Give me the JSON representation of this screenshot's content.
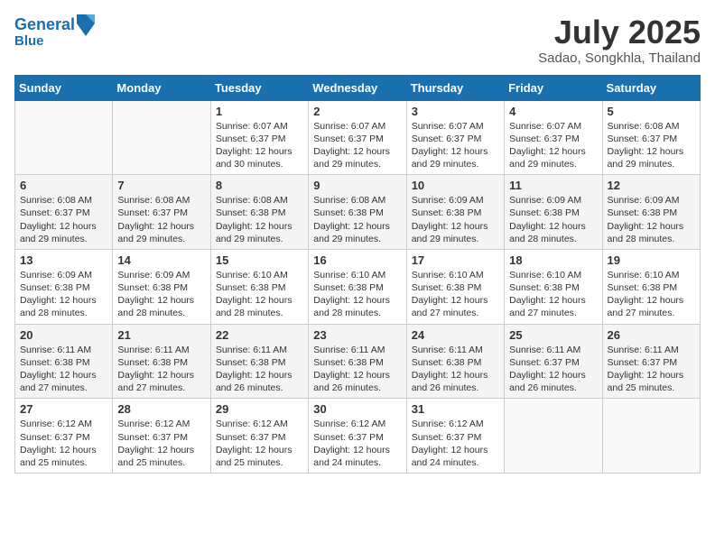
{
  "header": {
    "logo_line1": "General",
    "logo_line2": "Blue",
    "month_title": "July 2025",
    "location": "Sadao, Songkhla, Thailand"
  },
  "days_of_week": [
    "Sunday",
    "Monday",
    "Tuesday",
    "Wednesday",
    "Thursday",
    "Friday",
    "Saturday"
  ],
  "weeks": [
    [
      {
        "day": "",
        "empty": true
      },
      {
        "day": "",
        "empty": true
      },
      {
        "day": "1",
        "sunrise": "Sunrise: 6:07 AM",
        "sunset": "Sunset: 6:37 PM",
        "daylight": "Daylight: 12 hours and 30 minutes."
      },
      {
        "day": "2",
        "sunrise": "Sunrise: 6:07 AM",
        "sunset": "Sunset: 6:37 PM",
        "daylight": "Daylight: 12 hours and 29 minutes."
      },
      {
        "day": "3",
        "sunrise": "Sunrise: 6:07 AM",
        "sunset": "Sunset: 6:37 PM",
        "daylight": "Daylight: 12 hours and 29 minutes."
      },
      {
        "day": "4",
        "sunrise": "Sunrise: 6:07 AM",
        "sunset": "Sunset: 6:37 PM",
        "daylight": "Daylight: 12 hours and 29 minutes."
      },
      {
        "day": "5",
        "sunrise": "Sunrise: 6:08 AM",
        "sunset": "Sunset: 6:37 PM",
        "daylight": "Daylight: 12 hours and 29 minutes."
      }
    ],
    [
      {
        "day": "6",
        "sunrise": "Sunrise: 6:08 AM",
        "sunset": "Sunset: 6:37 PM",
        "daylight": "Daylight: 12 hours and 29 minutes."
      },
      {
        "day": "7",
        "sunrise": "Sunrise: 6:08 AM",
        "sunset": "Sunset: 6:37 PM",
        "daylight": "Daylight: 12 hours and 29 minutes."
      },
      {
        "day": "8",
        "sunrise": "Sunrise: 6:08 AM",
        "sunset": "Sunset: 6:38 PM",
        "daylight": "Daylight: 12 hours and 29 minutes."
      },
      {
        "day": "9",
        "sunrise": "Sunrise: 6:08 AM",
        "sunset": "Sunset: 6:38 PM",
        "daylight": "Daylight: 12 hours and 29 minutes."
      },
      {
        "day": "10",
        "sunrise": "Sunrise: 6:09 AM",
        "sunset": "Sunset: 6:38 PM",
        "daylight": "Daylight: 12 hours and 29 minutes."
      },
      {
        "day": "11",
        "sunrise": "Sunrise: 6:09 AM",
        "sunset": "Sunset: 6:38 PM",
        "daylight": "Daylight: 12 hours and 28 minutes."
      },
      {
        "day": "12",
        "sunrise": "Sunrise: 6:09 AM",
        "sunset": "Sunset: 6:38 PM",
        "daylight": "Daylight: 12 hours and 28 minutes."
      }
    ],
    [
      {
        "day": "13",
        "sunrise": "Sunrise: 6:09 AM",
        "sunset": "Sunset: 6:38 PM",
        "daylight": "Daylight: 12 hours and 28 minutes."
      },
      {
        "day": "14",
        "sunrise": "Sunrise: 6:09 AM",
        "sunset": "Sunset: 6:38 PM",
        "daylight": "Daylight: 12 hours and 28 minutes."
      },
      {
        "day": "15",
        "sunrise": "Sunrise: 6:10 AM",
        "sunset": "Sunset: 6:38 PM",
        "daylight": "Daylight: 12 hours and 28 minutes."
      },
      {
        "day": "16",
        "sunrise": "Sunrise: 6:10 AM",
        "sunset": "Sunset: 6:38 PM",
        "daylight": "Daylight: 12 hours and 28 minutes."
      },
      {
        "day": "17",
        "sunrise": "Sunrise: 6:10 AM",
        "sunset": "Sunset: 6:38 PM",
        "daylight": "Daylight: 12 hours and 27 minutes."
      },
      {
        "day": "18",
        "sunrise": "Sunrise: 6:10 AM",
        "sunset": "Sunset: 6:38 PM",
        "daylight": "Daylight: 12 hours and 27 minutes."
      },
      {
        "day": "19",
        "sunrise": "Sunrise: 6:10 AM",
        "sunset": "Sunset: 6:38 PM",
        "daylight": "Daylight: 12 hours and 27 minutes."
      }
    ],
    [
      {
        "day": "20",
        "sunrise": "Sunrise: 6:11 AM",
        "sunset": "Sunset: 6:38 PM",
        "daylight": "Daylight: 12 hours and 27 minutes."
      },
      {
        "day": "21",
        "sunrise": "Sunrise: 6:11 AM",
        "sunset": "Sunset: 6:38 PM",
        "daylight": "Daylight: 12 hours and 27 minutes."
      },
      {
        "day": "22",
        "sunrise": "Sunrise: 6:11 AM",
        "sunset": "Sunset: 6:38 PM",
        "daylight": "Daylight: 12 hours and 26 minutes."
      },
      {
        "day": "23",
        "sunrise": "Sunrise: 6:11 AM",
        "sunset": "Sunset: 6:38 PM",
        "daylight": "Daylight: 12 hours and 26 minutes."
      },
      {
        "day": "24",
        "sunrise": "Sunrise: 6:11 AM",
        "sunset": "Sunset: 6:38 PM",
        "daylight": "Daylight: 12 hours and 26 minutes."
      },
      {
        "day": "25",
        "sunrise": "Sunrise: 6:11 AM",
        "sunset": "Sunset: 6:37 PM",
        "daylight": "Daylight: 12 hours and 26 minutes."
      },
      {
        "day": "26",
        "sunrise": "Sunrise: 6:11 AM",
        "sunset": "Sunset: 6:37 PM",
        "daylight": "Daylight: 12 hours and 25 minutes."
      }
    ],
    [
      {
        "day": "27",
        "sunrise": "Sunrise: 6:12 AM",
        "sunset": "Sunset: 6:37 PM",
        "daylight": "Daylight: 12 hours and 25 minutes."
      },
      {
        "day": "28",
        "sunrise": "Sunrise: 6:12 AM",
        "sunset": "Sunset: 6:37 PM",
        "daylight": "Daylight: 12 hours and 25 minutes."
      },
      {
        "day": "29",
        "sunrise": "Sunrise: 6:12 AM",
        "sunset": "Sunset: 6:37 PM",
        "daylight": "Daylight: 12 hours and 25 minutes."
      },
      {
        "day": "30",
        "sunrise": "Sunrise: 6:12 AM",
        "sunset": "Sunset: 6:37 PM",
        "daylight": "Daylight: 12 hours and 24 minutes."
      },
      {
        "day": "31",
        "sunrise": "Sunrise: 6:12 AM",
        "sunset": "Sunset: 6:37 PM",
        "daylight": "Daylight: 12 hours and 24 minutes."
      },
      {
        "day": "",
        "empty": true
      },
      {
        "day": "",
        "empty": true
      }
    ]
  ]
}
